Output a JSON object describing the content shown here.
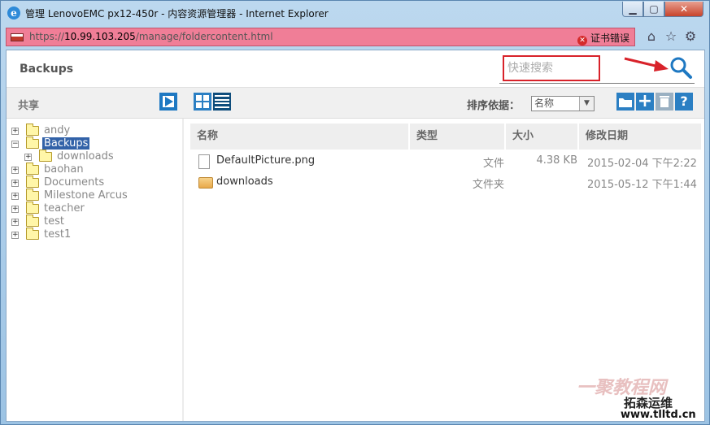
{
  "window": {
    "title": "管理 LenovoEMC px12-450r - 内容资源管理器 - Internet Explorer",
    "min_label": "▁",
    "max_label": "▢",
    "close_label": "✕"
  },
  "address": {
    "proto": "https://",
    "host": "10.99.103.205",
    "path": "/manage/foldercontent.html",
    "cert_error": "证书错误"
  },
  "header": {
    "title": "Backups",
    "search_placeholder": "快速搜索"
  },
  "toolbar": {
    "share_label": "共享",
    "sort_label": "排序依据：",
    "sort_value": "名称"
  },
  "tree": {
    "items": [
      {
        "label": "andy"
      },
      {
        "label": "Backups"
      },
      {
        "label": "downloads"
      },
      {
        "label": "baohan"
      },
      {
        "label": "Documents"
      },
      {
        "label": "Milestone Arcus"
      },
      {
        "label": "teacher"
      },
      {
        "label": "test"
      },
      {
        "label": "test1"
      }
    ]
  },
  "files": {
    "columns": [
      "名称",
      "类型",
      "大小",
      "修改日期"
    ],
    "rows": [
      {
        "name": "DefaultPicture.png",
        "type": "文件",
        "size": "4.38 KB",
        "date": "2015-02-04 下午2:22"
      },
      {
        "name": "downloads",
        "type": "文件夹",
        "size": "",
        "date": "2015-05-12 下午1:44"
      }
    ]
  },
  "watermark": {
    "line1": "一聚教程网",
    "line2": "拓森运维",
    "url": "www.tlltd.cn"
  },
  "colors": {
    "accent": "#2b7fc3",
    "address_bar": "#f07e97",
    "highlight_box": "#d8222a",
    "selected": "#3262a8"
  }
}
